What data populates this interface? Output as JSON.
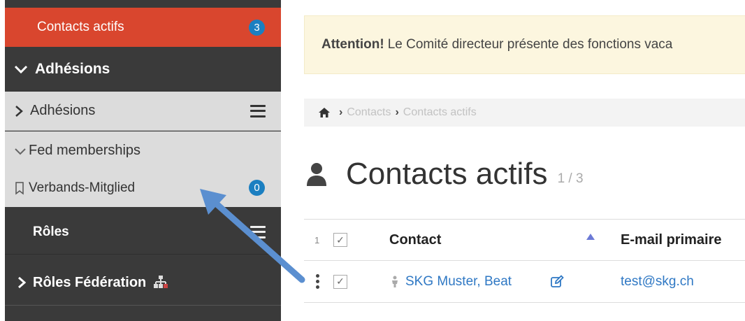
{
  "sidebar": {
    "active_item": {
      "label": "Contacts actifs",
      "count": "3"
    },
    "adhesions_header": "Adhésions",
    "adhesions_item": "Adhésions",
    "fed_header": "Fed memberships",
    "verbands_item": {
      "label": "Verbands-Mitglied",
      "count": "0"
    },
    "roles_label": "Rôles",
    "roles_federation_label": "Rôles Fédération"
  },
  "alert": {
    "strong": "Attention!",
    "text": "Le Comité directeur présente des fonctions vaca"
  },
  "breadcrumb": {
    "home_icon": "home-icon",
    "items": [
      "Contacts",
      "Contacts actifs"
    ]
  },
  "page": {
    "title": "Contacts actifs",
    "count": "1 / 3"
  },
  "table": {
    "selected_count": "1",
    "columns": [
      "Contact",
      "E-mail primaire"
    ],
    "rows": [
      {
        "contact": "SKG Muster, Beat",
        "email": "test@skg.ch"
      }
    ]
  },
  "colors": {
    "active": "#d9462e",
    "sidebar": "#3a3a3a",
    "badge": "#1b7fc1",
    "link": "#2f78c4",
    "arrow": "#5b8fd0"
  }
}
